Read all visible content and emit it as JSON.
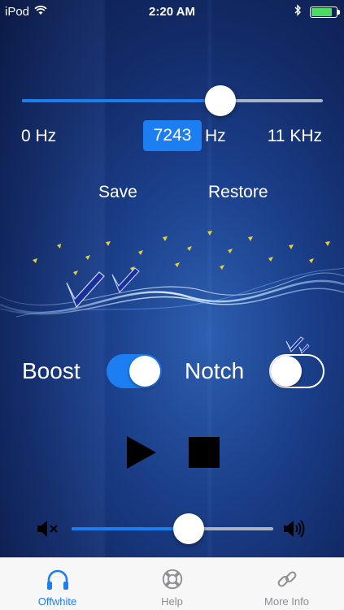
{
  "status_bar": {
    "carrier": "iPod",
    "time": "2:20 AM",
    "battery_percent": 90
  },
  "frequency": {
    "min_label": "0 Hz",
    "value": "7243",
    "unit": "Hz",
    "max_label": "11 KHz",
    "slider_position": 0.66
  },
  "actions": {
    "save_label": "Save",
    "restore_label": "Restore"
  },
  "boost": {
    "label": "Boost",
    "on": true
  },
  "notch": {
    "label": "Notch",
    "on": false
  },
  "volume": {
    "level": 0.58
  },
  "tabs": [
    {
      "label": "Offwhite",
      "icon": "headphones-icon",
      "active": true
    },
    {
      "label": "Help",
      "icon": "lifebuoy-icon",
      "active": false
    },
    {
      "label": "More Info",
      "icon": "link-icon",
      "active": false
    }
  ],
  "colors": {
    "accent": "#1d7ef2",
    "switch_on": "#1d7ef2",
    "battery": "#4cd964"
  }
}
